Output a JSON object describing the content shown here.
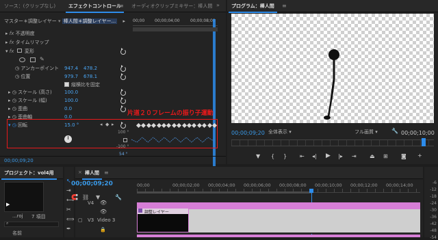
{
  "source_panel": {
    "tabs": [
      {
        "label": "ソース：(クリップなし)"
      },
      {
        "label": "エフェクトコントロール"
      },
      {
        "label": "オーディオクリップミキサー：棒人間"
      }
    ]
  },
  "effect_controls": {
    "master_label": "マスター＊調整レイヤー",
    "clip_label": "棒人間＊調整レイヤー...",
    "timecodes": [
      "00;00",
      "00;00;04;00",
      "00;00;08;00"
    ],
    "effects": {
      "opacity": "不透明度",
      "time_remap": "タイムリマップ",
      "transform": "変形"
    },
    "properties": {
      "anchor": {
        "label": "アンカーポイント",
        "x": "947.4",
        "y": "478.2"
      },
      "position": {
        "label": "位置",
        "x": "979.7",
        "y": "678.1"
      },
      "uniform_scale": "縦横比を固定",
      "scale_h": {
        "label": "スケール (高さ)",
        "value": "100.0"
      },
      "scale_w": {
        "label": "スケール (幅)",
        "value": "100.0"
      },
      "skew": {
        "label": "歪曲",
        "value": "0.0"
      },
      "skew_axis": {
        "label": "歪曲軸",
        "value": "0.0"
      },
      "rotation": {
        "label": "回転",
        "value": "15.0 °"
      }
    },
    "graph_labels": {
      "top": "100 °",
      "mid": "-100 °",
      "bottom": "54 °"
    },
    "current_time": "00;00;09;20",
    "annotation": "片道２０フレームの振り子運動"
  },
  "program_monitor": {
    "title": "プログラム：棒人間",
    "current_time": "00;00;09;20",
    "fit": "全体表示",
    "quality": "フル画質",
    "duration": "00;00;10;00"
  },
  "project_panel": {
    "title": "プロジェクト：vol4用",
    "filename": "...roj",
    "count": "7 項目",
    "col_name": "名前"
  },
  "timeline": {
    "tab": "棒人間",
    "timecode": "00;00;09;20",
    "ruler": [
      "00;00",
      "00;00;02;00",
      "00;00;04;00",
      "00;00;06;00",
      "00;00;08;00",
      "00;00;10;00",
      "00;00;12;00",
      "00;00;14;00"
    ],
    "tracks": [
      {
        "name": "V4"
      },
      {
        "name": "V3",
        "label": "Video 3"
      }
    ],
    "clip_label": "調整レイヤー"
  },
  "audio_meter": {
    "labels": [
      "-6",
      "-12",
      "-18",
      "-24",
      "-30",
      "-36",
      "-42",
      "-48",
      "-54"
    ]
  },
  "colors": {
    "accent_blue": "#2d8ceb",
    "annotation_red": "#e8191b",
    "clip_pink": "#d67ed6"
  }
}
